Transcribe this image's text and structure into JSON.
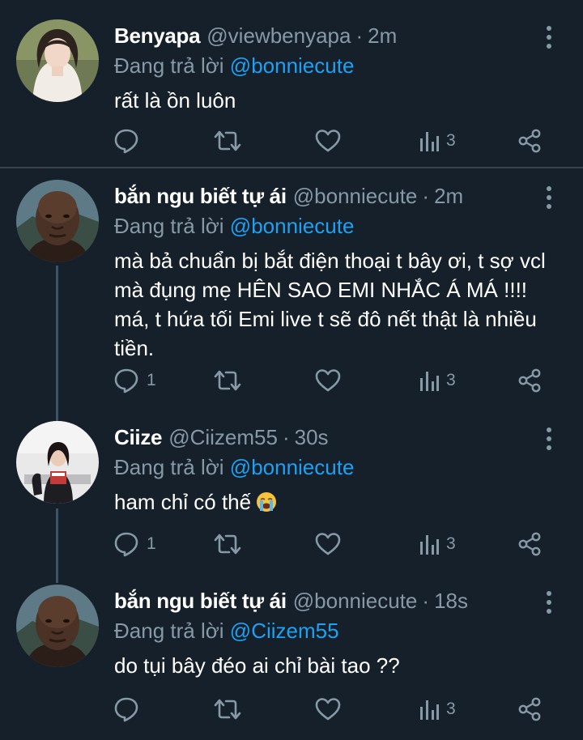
{
  "colors": {
    "background": "#15202b",
    "text": "#ffffff",
    "muted": "#8899a6",
    "mention": "#1da1f2",
    "separator": "#38444d",
    "thread_line": "#3d5466"
  },
  "icons": {
    "reply": "reply-icon",
    "retweet": "retweet-icon",
    "like": "heart-icon",
    "views": "bar-chart-icon",
    "share": "share-icon",
    "more": "more-vertical-icon"
  },
  "tweets": [
    {
      "name": "Benyapa",
      "handle": "@viewbenyapa",
      "dot": "·",
      "time": "2m",
      "reply_prefix": "Đang trả lời",
      "reply_to": "@bonniecute",
      "text": "rất là ồn luôn",
      "replies": "",
      "views": "3"
    },
    {
      "name": "bắn ngu biết tự ái",
      "handle": "@bonniecute",
      "dot": "·",
      "time": "2m",
      "reply_prefix": "Đang trả lời",
      "reply_to": "@bonniecute",
      "text": "mà bả chuẩn bị bắt điện thoại t bây ơi, t sợ vcl mà đụng mẹ HÊN SAO EMI NHẮC Á MÁ !!!! má, t hứa tối Emi live t sẽ đô nết thật là nhiều tiền.",
      "replies": "1",
      "views": "3"
    },
    {
      "name": "Ciize",
      "handle": "@Ciizem55",
      "dot": "·",
      "time": "30s",
      "reply_prefix": "Đang trả lời",
      "reply_to": "@bonniecute",
      "text": "ham chỉ có thế",
      "emoji": "crying-face-emoji",
      "replies": "1",
      "views": "3"
    },
    {
      "name": "bắn ngu biết tự ái",
      "handle": "@bonniecute",
      "dot": "·",
      "time": "18s",
      "reply_prefix": "Đang trả lời",
      "reply_to": "@Ciizem55",
      "text": "do tụi bây đéo ai chỉ bài tao ??",
      "replies": "",
      "views": "3"
    }
  ]
}
